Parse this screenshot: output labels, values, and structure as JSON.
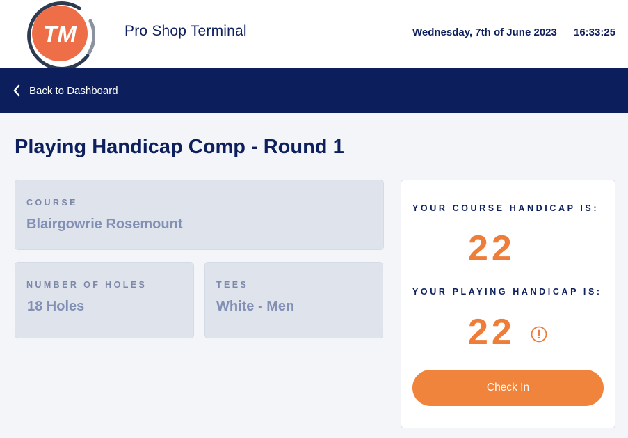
{
  "header": {
    "logo_text": "TM",
    "app_title": "Pro Shop Terminal",
    "date": "Wednesday, 7th of June 2023",
    "time": "16:33:25"
  },
  "nav": {
    "back_label": "Back to Dashboard"
  },
  "page": {
    "title": "Playing Handicap Comp - Round 1"
  },
  "details": {
    "course_label": "COURSE",
    "course_value": "Blairgowrie Rosemount",
    "holes_label": "NUMBER OF HOLES",
    "holes_value": "18 Holes",
    "tees_label": "TEES",
    "tees_value": "White - Men"
  },
  "handicap": {
    "course_label": "YOUR COURSE HANDICAP IS:",
    "course_value": "22",
    "playing_label": "YOUR PLAYING HANDICAP IS:",
    "playing_value": "22",
    "checkin_label": "Check In"
  },
  "colors": {
    "brand_orange": "#ee7d39",
    "navy": "#0c1e5b",
    "button_orange": "#f0843d"
  }
}
